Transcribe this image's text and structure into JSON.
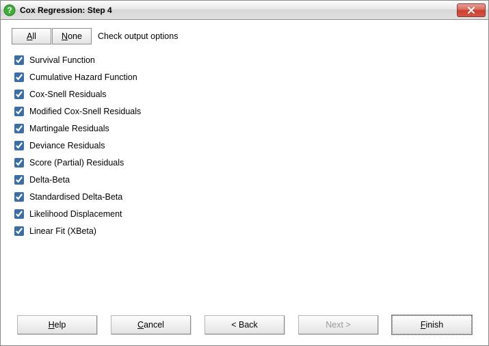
{
  "window": {
    "title": "Cox Regression: Step 4",
    "close_icon": "close"
  },
  "toolbar": {
    "all_label": "All",
    "all_hotkey": "A",
    "none_label": "None",
    "none_hotkey": "N",
    "hint": "Check output options"
  },
  "options": [
    {
      "label": "Survival Function",
      "checked": true
    },
    {
      "label": "Cumulative Hazard Function",
      "checked": true
    },
    {
      "label": "Cox-Snell Residuals",
      "checked": true
    },
    {
      "label": "Modified Cox-Snell Residuals",
      "checked": true
    },
    {
      "label": "Martingale Residuals",
      "checked": true
    },
    {
      "label": "Deviance Residuals",
      "checked": true
    },
    {
      "label": "Score (Partial) Residuals",
      "checked": true
    },
    {
      "label": "Delta-Beta",
      "checked": true
    },
    {
      "label": "Standardised Delta-Beta",
      "checked": true
    },
    {
      "label": "Likelihood Displacement",
      "checked": true
    },
    {
      "label": "Linear Fit (XBeta)",
      "checked": true
    }
  ],
  "buttons": {
    "help": {
      "pre": "",
      "hot": "H",
      "post": "elp",
      "enabled": true
    },
    "cancel": {
      "pre": "",
      "hot": "C",
      "post": "ancel",
      "enabled": true
    },
    "back": {
      "pre": "",
      "hot": "<",
      "post": " Back",
      "enabled": true,
      "hot_underline": false
    },
    "next": {
      "pre": "Next ",
      "hot": ">",
      "post": "",
      "enabled": false,
      "hot_underline": false
    },
    "finish": {
      "pre": "",
      "hot": "F",
      "post": "inish",
      "enabled": true,
      "default": true
    }
  }
}
